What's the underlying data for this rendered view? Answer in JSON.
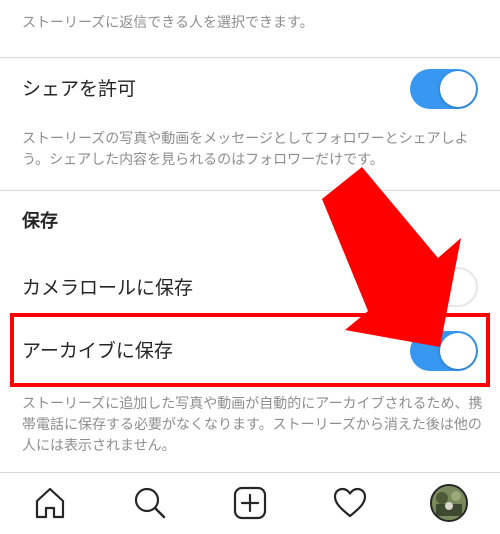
{
  "top_description": "ストーリーズに返信できる人を選択できます。",
  "share": {
    "label": "シェアを許可",
    "enabled": true,
    "description": "ストーリーズの写真や動画をメッセージとしてフォロワーとシェアしよう。シェアした内容を見られるのはフォロワーだけです。"
  },
  "save_section": {
    "heading": "保存",
    "camera_roll": {
      "label": "カメラロールに保存",
      "enabled": false
    },
    "archive": {
      "label": "アーカイブに保存",
      "enabled": true,
      "description": "ストーリーズに追加した写真や動画が自動的にアーカイブされるため、携帯電話に保存する必要がなくなります。ストーリーズから消えた後は他の人には表示されません。"
    }
  },
  "colors": {
    "toggle_on": "#3897f0",
    "highlight": "#ff0000",
    "arrow": "#ff0000"
  },
  "bottom_nav": {
    "items": [
      {
        "icon": "home-icon"
      },
      {
        "icon": "search-icon"
      },
      {
        "icon": "new-post-icon"
      },
      {
        "icon": "heart-icon"
      },
      {
        "icon": "profile-avatar"
      }
    ]
  }
}
